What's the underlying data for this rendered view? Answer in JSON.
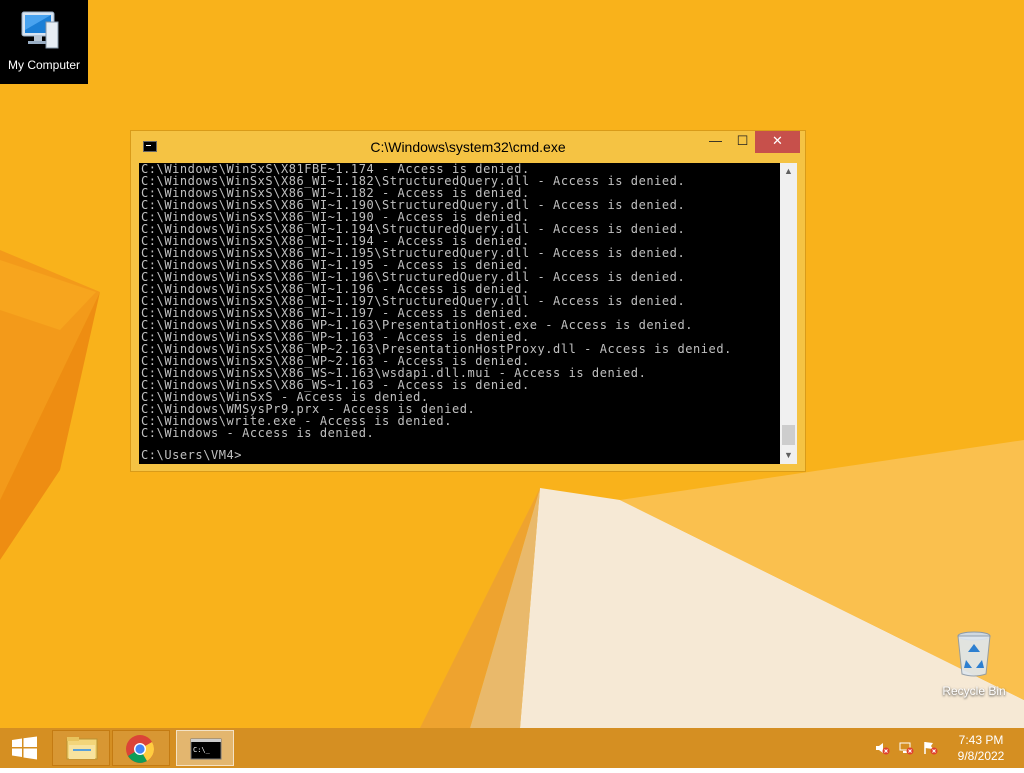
{
  "desktop": {
    "icons": [
      {
        "label": "My Computer"
      },
      {
        "label": "Recycle Bin"
      }
    ]
  },
  "cmd": {
    "title": "C:\\Windows\\system32\\cmd.exe",
    "buttons": {
      "minimize": "—",
      "maximize": "☐",
      "close": "✕"
    },
    "lines": [
      "C:\\Windows\\WinSxS\\X81FBE~1.174 - Access is denied.",
      "C:\\Windows\\WinSxS\\X86_WI~1.182\\StructuredQuery.dll - Access is denied.",
      "C:\\Windows\\WinSxS\\X86_WI~1.182 - Access is denied.",
      "C:\\Windows\\WinSxS\\X86_WI~1.190\\StructuredQuery.dll - Access is denied.",
      "C:\\Windows\\WinSxS\\X86_WI~1.190 - Access is denied.",
      "C:\\Windows\\WinSxS\\X86_WI~1.194\\StructuredQuery.dll - Access is denied.",
      "C:\\Windows\\WinSxS\\X86_WI~1.194 - Access is denied.",
      "C:\\Windows\\WinSxS\\X86_WI~1.195\\StructuredQuery.dll - Access is denied.",
      "C:\\Windows\\WinSxS\\X86_WI~1.195 - Access is denied.",
      "C:\\Windows\\WinSxS\\X86_WI~1.196\\StructuredQuery.dll - Access is denied.",
      "C:\\Windows\\WinSxS\\X86_WI~1.196 - Access is denied.",
      "C:\\Windows\\WinSxS\\X86_WI~1.197\\StructuredQuery.dll - Access is denied.",
      "C:\\Windows\\WinSxS\\X86_WI~1.197 - Access is denied.",
      "C:\\Windows\\WinSxS\\X86_WP~1.163\\PresentationHost.exe - Access is denied.",
      "C:\\Windows\\WinSxS\\X86_WP~1.163 - Access is denied.",
      "C:\\Windows\\WinSxS\\X86_WP~2.163\\PresentationHostProxy.dll - Access is denied.",
      "C:\\Windows\\WinSxS\\X86_WP~2.163 - Access is denied.",
      "C:\\Windows\\WinSxS\\X86_WS~1.163\\wsdapi.dll.mui - Access is denied.",
      "C:\\Windows\\WinSxS\\X86_WS~1.163 - Access is denied.",
      "C:\\Windows\\WinSxS - Access is denied.",
      "C:\\Windows\\WMSysPr9.prx - Access is denied.",
      "C:\\Windows\\write.exe - Access is denied.",
      "C:\\Windows - Access is denied."
    ],
    "prompt": "C:\\Users\\VM4>"
  },
  "taskbar": {
    "items": [
      "File Explorer",
      "Google Chrome",
      "Command Prompt"
    ],
    "clock": {
      "time": "7:43 PM",
      "date": "9/8/2022"
    },
    "tray_icons": [
      "volume-muted-icon",
      "network-icon",
      "action-center-flag-icon"
    ]
  },
  "colors": {
    "desktop": "#f9b21b",
    "taskbar": "#d58f22",
    "window_frame": "#f5c343",
    "close_button": "#c7504b",
    "console_bg": "#000000",
    "console_text": "#c0c0c0"
  }
}
